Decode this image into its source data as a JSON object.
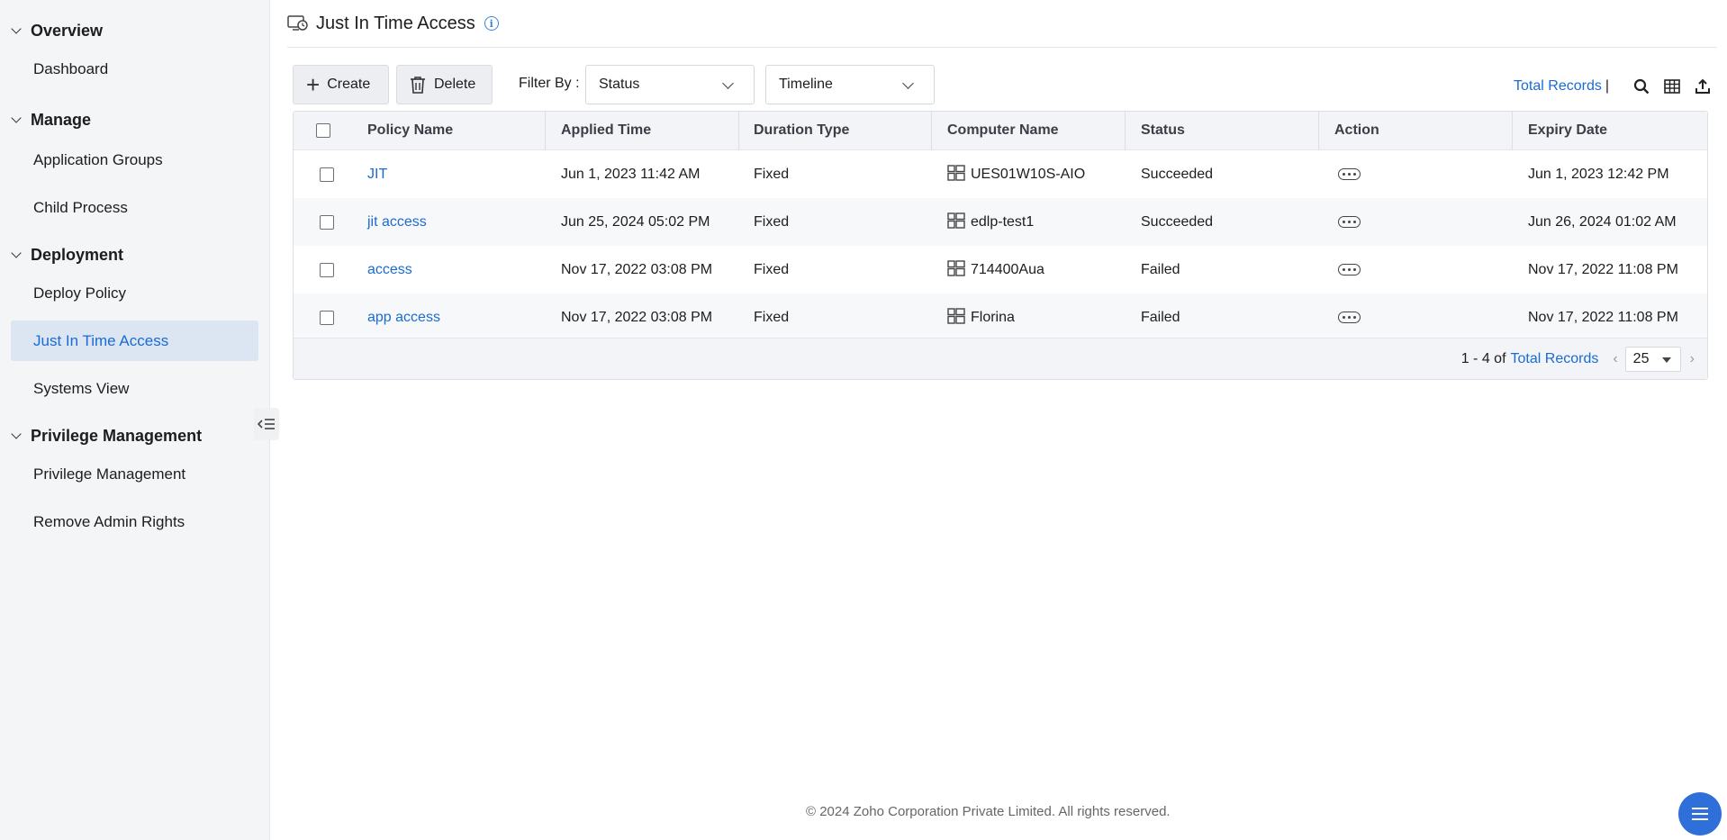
{
  "sidebar": {
    "sections": [
      {
        "title": "Overview",
        "items": [
          "Dashboard"
        ]
      },
      {
        "title": "Manage",
        "items": [
          "Application Groups",
          "Child Process"
        ]
      },
      {
        "title": "Deployment",
        "items": [
          "Deploy Policy",
          "Just In Time Access",
          "Systems View"
        ]
      },
      {
        "title": "Privilege Management",
        "items": [
          "Privilege Management",
          "Remove Admin Rights"
        ]
      }
    ],
    "active_item": "Just In Time Access"
  },
  "header": {
    "title": "Just In Time Access",
    "info_glyph": "i"
  },
  "toolbar": {
    "create_label": "Create",
    "delete_label": "Delete",
    "filter_label": "Filter By :",
    "status_select": "Status",
    "timeline_select": "Timeline",
    "total_records_link": "Total Records",
    "separator": "|"
  },
  "table": {
    "columns": [
      "Policy Name",
      "Applied Time",
      "Duration Type",
      "Computer Name",
      "Status",
      "Action",
      "Expiry Date"
    ],
    "rows": [
      {
        "policy": "JIT",
        "applied": "Jun 1, 2023 11:42 AM",
        "duration": "Fixed",
        "computer": "UES01W10S-AIO",
        "status": "Succeeded",
        "expiry": "Jun 1, 2023 12:42 PM"
      },
      {
        "policy": "jit access",
        "applied": "Jun 25, 2024 05:02 PM",
        "duration": "Fixed",
        "computer": "edlp-test1",
        "status": "Succeeded",
        "expiry": "Jun 26, 2024 01:02 AM"
      },
      {
        "policy": "access",
        "applied": "Nov 17, 2022 03:08 PM",
        "duration": "Fixed",
        "computer": "714400Aua",
        "status": "Failed",
        "expiry": "Nov 17, 2022 11:08 PM"
      },
      {
        "policy": "app access",
        "applied": "Nov 17, 2022 03:08 PM",
        "duration": "Fixed",
        "computer": "Florina",
        "status": "Failed",
        "expiry": "Nov 17, 2022 11:08 PM"
      }
    ]
  },
  "pagination": {
    "range": "1 - 4 of",
    "total_link": "Total Records",
    "per_page": "25",
    "prev": "‹",
    "next": "›"
  },
  "footer": {
    "copyright": "© 2024 Zoho Corporation Private Limited. All rights reserved."
  },
  "colors": {
    "accent": "#1a6bd2",
    "active_bg": "#dce6f2",
    "fab": "#2f6fd9"
  },
  "icons": [
    "chevron-down-icon",
    "collapse-sidebar-icon",
    "jit-access-icon",
    "info-icon",
    "plus-icon",
    "trash-icon",
    "search-icon",
    "columns-icon",
    "export-icon",
    "windows-icon",
    "more-options-icon",
    "menu-icon"
  ]
}
